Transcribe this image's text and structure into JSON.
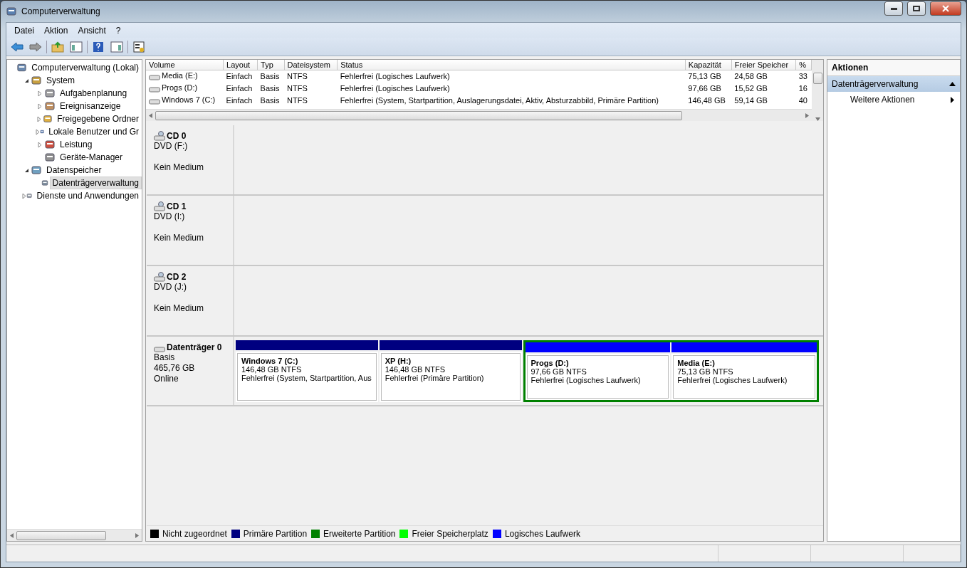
{
  "window": {
    "title": "Computerverwaltung"
  },
  "menu": [
    {
      "label": "Datei"
    },
    {
      "label": "Aktion"
    },
    {
      "label": "Ansicht"
    },
    {
      "label": "?"
    }
  ],
  "tree": [
    {
      "label": "Computerverwaltung (Lokal)",
      "selected": false,
      "children": [
        {
          "label": "System",
          "expanded": true,
          "selected": false,
          "children": [
            {
              "label": "Aufgabenplanung",
              "expanded": false,
              "selected": false
            },
            {
              "label": "Ereignisanzeige",
              "expanded": false,
              "selected": false
            },
            {
              "label": "Freigegebene Ordner",
              "expanded": false,
              "selected": false
            },
            {
              "label": "Lokale Benutzer und Gr",
              "expanded": false,
              "selected": false
            },
            {
              "label": "Leistung",
              "expanded": false,
              "selected": false
            },
            {
              "label": "Geräte-Manager",
              "selected": false
            }
          ]
        },
        {
          "label": "Datenspeicher",
          "expanded": true,
          "selected": false,
          "children": [
            {
              "label": "Datenträgerverwaltung",
              "selected": true
            }
          ]
        },
        {
          "label": "Dienste und Anwendungen",
          "expanded": false,
          "selected": false
        }
      ]
    }
  ],
  "volumes": {
    "columns": [
      "Volume",
      "Layout",
      "Typ",
      "Dateisystem",
      "Status",
      "Kapazität",
      "Freier Speicher",
      "%"
    ],
    "rows": [
      [
        "Media (E:)",
        "Einfach",
        "Basis",
        "NTFS",
        "Fehlerfrei (Logisches Laufwerk)",
        "75,13 GB",
        "24,58 GB",
        "33"
      ],
      [
        "Progs (D:)",
        "Einfach",
        "Basis",
        "NTFS",
        "Fehlerfrei (Logisches Laufwerk)",
        "97,66 GB",
        "15,52 GB",
        "16"
      ],
      [
        "Windows 7 (C:)",
        "Einfach",
        "Basis",
        "NTFS",
        "Fehlerfrei (System, Startpartition, Auslagerungsdatei, Aktiv, Absturzabbild, Primäre Partition)",
        "146,48 GB",
        "59,14 GB",
        "40"
      ]
    ]
  },
  "disks": [
    {
      "kind": "cd",
      "name": "CD 0",
      "lines": [
        "DVD (F:)"
      ],
      "media": "Kein Medium"
    },
    {
      "kind": "cd",
      "name": "CD 1",
      "lines": [
        "DVD (I:)"
      ],
      "media": "Kein Medium"
    },
    {
      "kind": "cd",
      "name": "CD 2",
      "lines": [
        "DVD (J:)"
      ],
      "media": "Kein Medium"
    },
    {
      "kind": "disk",
      "name": "Datenträger 0",
      "lines": [
        "Basis",
        "465,76 GB",
        "Online"
      ],
      "partitions": [
        {
          "kind": "primary",
          "color": "#000080",
          "name": "Windows 7  (C:)",
          "size": "146,48 GB NTFS",
          "status": "Fehlerfrei (System, Startpartition, Aus"
        },
        {
          "kind": "primary",
          "color": "#000080",
          "name": "XP  (H:)",
          "size": "146,48 GB NTFS",
          "status": "Fehlerfrei (Primäre Partition)"
        },
        {
          "kind": "extended",
          "color": "#008000",
          "children": [
            {
              "color": "#0000ff",
              "name": "Progs  (D:)",
              "size": "97,66 GB NTFS",
              "status": "Fehlerfrei (Logisches Laufwerk)"
            },
            {
              "color": "#0000ff",
              "name": "Media  (E:)",
              "size": "75,13 GB NTFS",
              "status": "Fehlerfrei (Logisches Laufwerk)"
            }
          ]
        }
      ]
    }
  ],
  "legend": [
    {
      "label": "Nicht zugeordnet",
      "color": "#000000"
    },
    {
      "label": "Primäre Partition",
      "color": "#000080"
    },
    {
      "label": "Erweiterte Partition",
      "color": "#008000"
    },
    {
      "label": "Freier Speicherplatz",
      "color": "#00ff00"
    },
    {
      "label": "Logisches Laufwerk",
      "color": "#0000ff"
    }
  ],
  "actions": {
    "title": "Aktionen",
    "sections": [
      {
        "label": "Datenträgerverwaltung",
        "expanded": true,
        "items": [
          "Weitere Aktionen"
        ]
      }
    ]
  }
}
